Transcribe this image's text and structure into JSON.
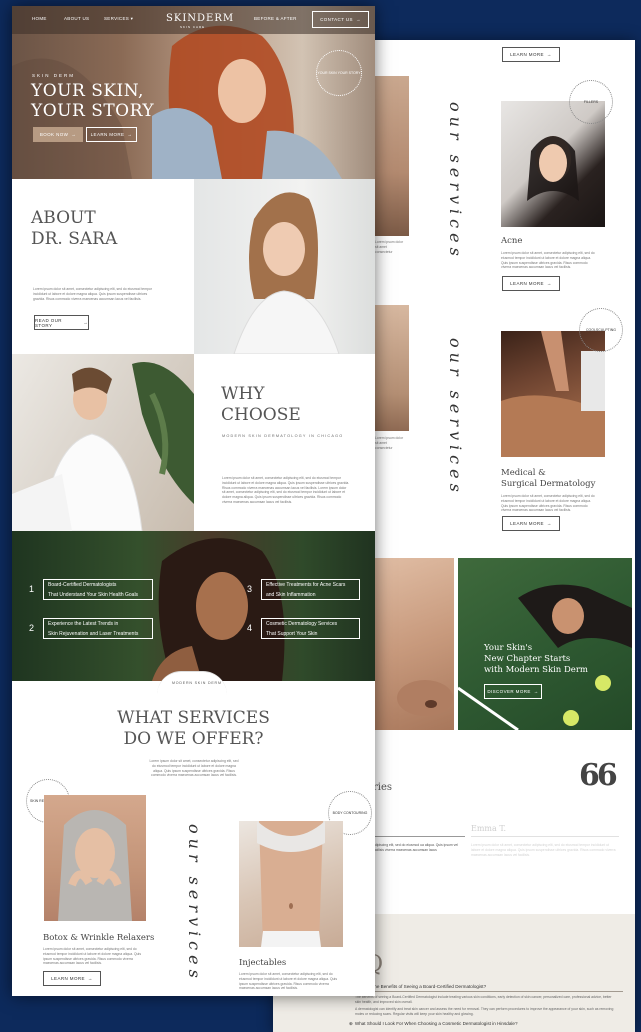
{
  "nav": {
    "home": "HOME",
    "about": "ABOUT US",
    "services": "SERVICES",
    "logo": "SKINDERM",
    "logo_sub": "SKIN CARE",
    "before_after": "BEFORE & AFTER",
    "contact": "CONTACT US"
  },
  "hero": {
    "eyebrow": "SKIN DERM",
    "title_line1": "YOUR SKIN,",
    "title_line2": "YOUR STORY",
    "book_btn": "BOOK NOW",
    "learn_btn": "LEARN MORE",
    "badge": "YOUR SKIN YOUR STORY"
  },
  "about": {
    "title_line1": "ABOUT",
    "title_line2": "DR. SARA",
    "body": "Lorem ipsum dolor sit amet, consectetur adipiscing elit, sed do eiusmod tempor incididunt ut labore et dolore magna aliqua. Quis ipsum suspendisse ultrices gravida. Risus commodo viverra maecenas accumsan lacus vel facilisis.",
    "button": "READ OUR STORY"
  },
  "why": {
    "title_line1": "WHY",
    "title_line2": "CHOOSE",
    "subtitle": "MODERN SKIN DERMATOLOGY IN CHICAGO",
    "body": "Lorem ipsum dolor sit amet, consectetur adipiscing elit, sed do eiusmod tempor incididunt ut labore et dolore magna aliqua. Quis ipsum suspendisse ultrices gravida. Risus commodo viverra maecenas accumsan lacus vel facilisis. Lorem ipsum dolor sit amet, consectetur adipiscing elit, sed do eiusmod tempor incididunt ut labore et dolore magna aliqua. Quis ipsum suspendisse ultrices gravida. Risus commodo viverra maecenas accumsan lacus vel facilisis."
  },
  "features": [
    {
      "num": "1",
      "line1": "Board-Certified Dermatologists",
      "line2": "That Understand Your Skin Health Goals"
    },
    {
      "num": "2",
      "line1": "Experience the Latest Trends in",
      "line2": "Skin Rejuvenation and Laser Treatments"
    },
    {
      "num": "3",
      "line1": "Effective Treatments for Acne Scars",
      "line2": "and Skin Inflammation"
    },
    {
      "num": "4",
      "line1": "Cosmetic Dermatology Services",
      "line2": "That Support Your Skin"
    }
  ],
  "services": {
    "arc": "MODERN SKIN DERM",
    "title_line1": "WHAT SERVICES",
    "title_line2": "DO WE OFFER?",
    "intro": "Lorem ipsum dolor sit amet, consectetur adipiscing elit, sed do eiusmod tempor incididunt ut labore et dolore magna aliqua. Quis ipsum suspendisse ultrices gravida. Risus commodo viverra maecenas accumsan lacus vel facilisis.",
    "script": "our services",
    "badge1": "SKIN REJUVENATION",
    "badge2": "BODY CONTOURING",
    "item1": "Botox & Wrinkle Relaxers",
    "item1_body": "Lorem ipsum dolor sit amet, consectetur adipiscing elit, sed do eiusmod tempor incididunt ut labore et dolore magna aliqua. Quis ipsum suspendisse ultrices gravida. Risus commodo viverra maecenas accumsan lacus vel facilisis.",
    "item2": "Injectables",
    "item2_body": "Lorem ipsum dolor sit amet, consectetur adipiscing elit, sed do eiusmod tempor incididunt ut labore et dolore magna aliqua. Quis ipsum suspendisse ultrices gravida. Risus commodo viverra maecenas accumsan lacus vel facilisis.",
    "learn": "LEARN MORE"
  },
  "back": {
    "learn": "LEARN MORE",
    "script": "our services",
    "acne": "Acne",
    "acne_body": "Lorem ipsum dolor sit amet, consectetur adipiscing elit, sed do eiusmod tempor incididunt ut labore et dolore magna aliqua. Quis ipsum suspendisse ultrices gravida. Risus commodo viverra maecenas accumsan lacus vel facilisis.",
    "fillers_badge": "FILLERS",
    "sculpt_badge": "COOLSCULPTING",
    "medical_line1": "Medical &",
    "medical_line2": "Surgical Dermatology",
    "medical_body": "Lorem ipsum dolor sit amet, consectetur adipiscing elit, sed do eiusmod tempor incididunt ut labore et dolore magna aliqua. Quis ipsum suspendisse ultrices gravida. Risus commodo viverra maecenas accumsan lacus vel facilisis.",
    "promo_line1": "Your Skin's",
    "promo_line2": "New Chapter Starts",
    "promo_line3": "with Modern Skin Derm",
    "discover": "DISCOVER MORE",
    "stories_partial": "ries",
    "quote_mark": "66",
    "testimonial_name": "Emma T.",
    "testimonial_body": "adipiscing elit, sed do eiusmod ua aliqua. Quis ipsum vel facilisis viverra maecenas accumsan lacus",
    "faq_letter": "Q",
    "faq_q1": "the Benefits of Seeing a Board-Certified Dermatologist?",
    "faq_a1": "The benefits of seeing a Board-Certified Dermatologist include treating various skin conditions, early detection of skin cancer, personalized care, professional advice, better skin health, and improved skin overall.",
    "faq_a1b": "A dermatologist can identify and treat skin cancer and assess the need for removal. They can perform procedures to improve the appearance of your skin, such as removing moles or reducing scars. Regular visits will keep your skin healthy and glowing.",
    "faq_q2": "What Should I Look For When Choosing a Cosmetic Dermatologist in Hinsdale?"
  }
}
